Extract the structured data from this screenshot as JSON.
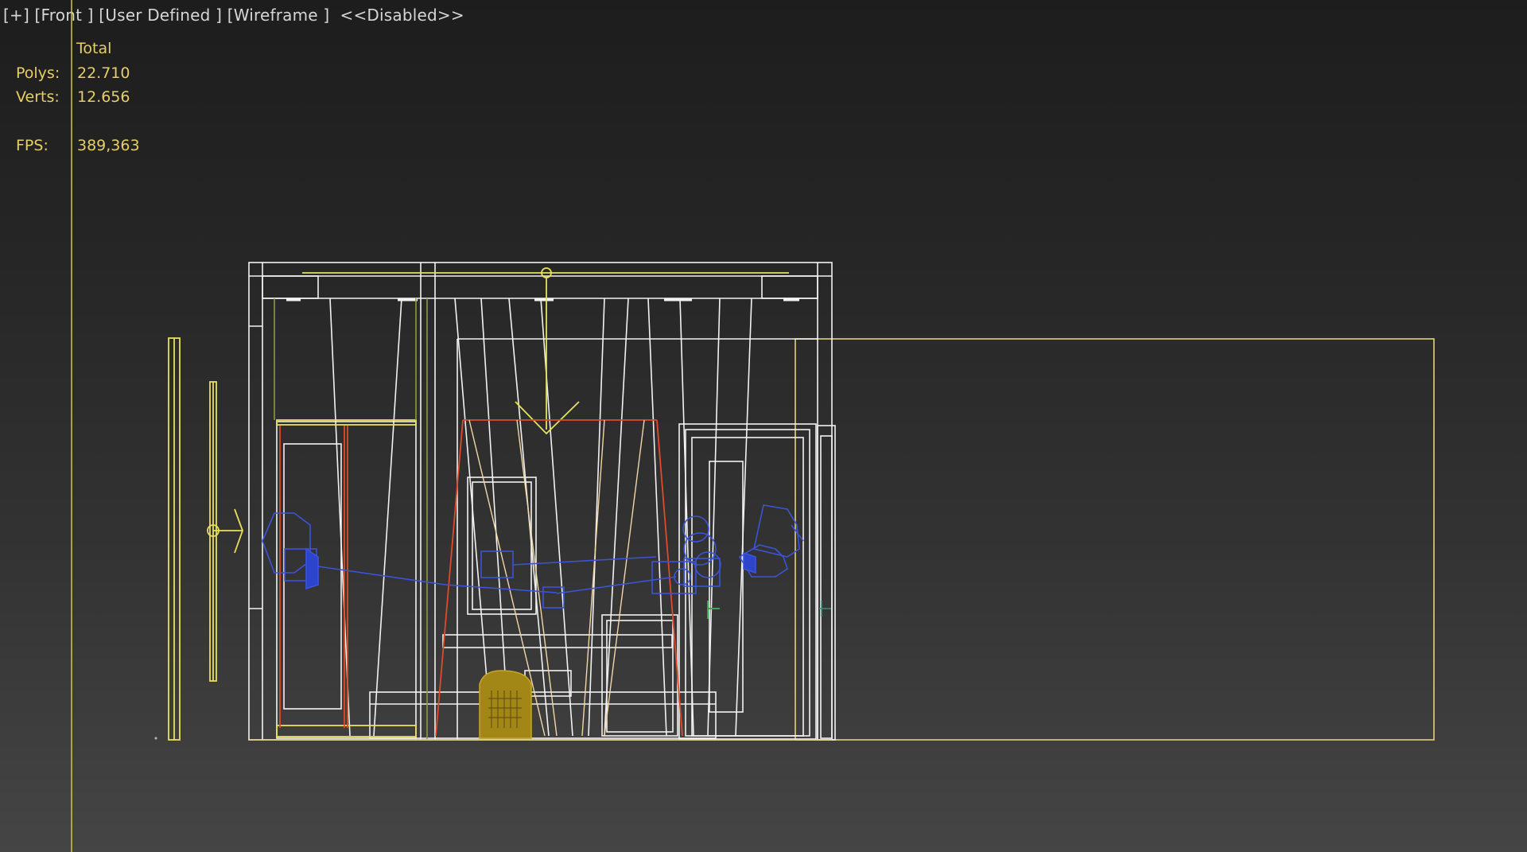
{
  "viewport": {
    "menu": {
      "plus": "[+]",
      "view": "[Front ]",
      "camera": "[User Defined ]",
      "shading": "[Wireframe ]",
      "status": "<<Disabled>>"
    },
    "stats": {
      "header": "Total",
      "polys_label": "Polys:",
      "polys_value": "22.710",
      "verts_label": "Verts:",
      "verts_value": "12.656",
      "fps_label": "FPS:",
      "fps_value": "389,363"
    },
    "colors": {
      "background_top": "#1d1d1d",
      "background_bottom": "#454545",
      "stats_text": "#e6cf64",
      "menu_text": "#d6d6d6",
      "wire_white": "#f2f2f2",
      "wire_yellow": "#e8e05a",
      "wire_red": "#e04a2a",
      "wire_blue": "#3b54d8",
      "wire_green": "#3aa84a",
      "selected_object": "#a38716"
    }
  }
}
